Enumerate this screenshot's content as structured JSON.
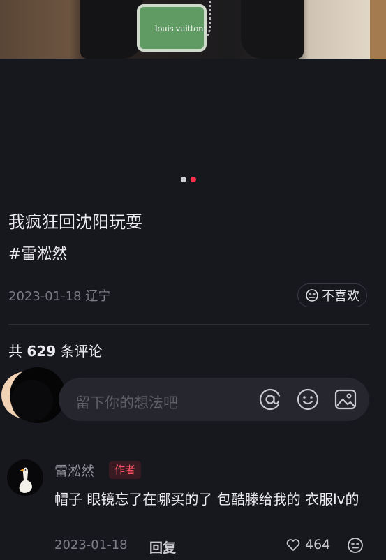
{
  "post": {
    "title": "我疯狂回沈阳玩耍",
    "tag": "#雷淞然",
    "date_location": "2023-01-18 辽宁",
    "dislike_label": "不喜欢",
    "image_brand_text": "louis vuitton"
  },
  "carousel": {
    "count": 2,
    "active_index": 1
  },
  "comments": {
    "count_prefix": "共",
    "count": "629",
    "count_suffix": "条评论",
    "input_placeholder": "留下你的想法吧",
    "input_icons": [
      "at-icon",
      "emoji-icon",
      "image-icon"
    ],
    "items": [
      {
        "author": "雷淞然",
        "badge": "作者",
        "text": "帽子 眼镜忘了在哪买的了 包酷滕给我的 衣服lv的",
        "date": "2023-01-18",
        "reply_label": "回复",
        "likes": "464"
      }
    ]
  },
  "colors": {
    "background": "#17171e",
    "accent": "#ff2e4d",
    "badge_bg": "#3a1b23"
  }
}
